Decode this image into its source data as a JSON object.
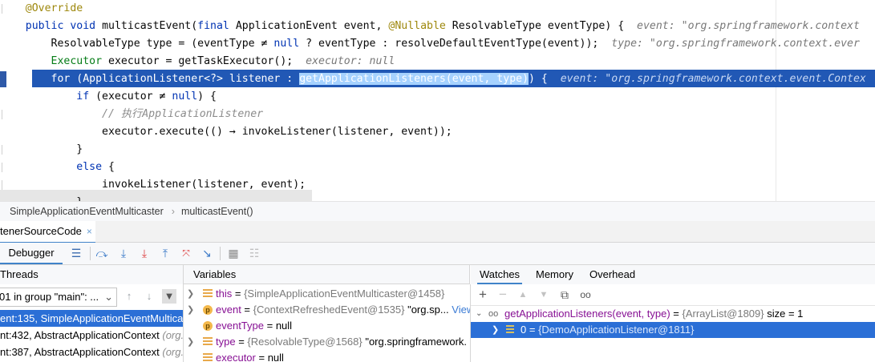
{
  "editor": {
    "lines": [
      {
        "indent": "    ",
        "annotation": "@Override"
      },
      {
        "indent": "    ",
        "kw1": "public",
        "kw2": "void",
        "text": " multicastEvent(",
        "kw3": "final",
        "text2": " ApplicationEvent event, ",
        "ann": "@Nullable",
        "text3": " ResolvableType eventType) {",
        "hint": "event: \"org.springframework.context"
      },
      {
        "indent": "        ",
        "text": "ResolvableType type = (eventType ≠ ",
        "kw": "null",
        "text2": " ? eventType : resolveDefaultEventType(event));",
        "hint": "type: \"org.springframework.context.ever"
      },
      {
        "indent": "        ",
        "cls": "Executor",
        "text": " executor = getTaskExecutor();",
        "hint": "executor: null"
      },
      {
        "indent": "        ",
        "kw": "for",
        "text": " (ApplicationListener<?> listener : ",
        "sel": "getApplicationListeners(event, type)",
        "text2": ") {",
        "hint": "event: \"org.springframework.context.event.Contex"
      },
      {
        "indent": "            ",
        "kw": "if",
        "text": " (executor ≠ ",
        "kw2": "null",
        "text2": ") {"
      },
      {
        "indent": "                ",
        "comment": "// 执行ApplicationListener"
      },
      {
        "indent": "                ",
        "text": "executor.execute(() → invokeListener(listener, event));"
      },
      {
        "indent": "            ",
        "text": "}"
      },
      {
        "indent": "            ",
        "kw": "else",
        "text": " {"
      },
      {
        "indent": "                ",
        "text": "invokeListener(listener, event);"
      },
      {
        "indent": "            ",
        "text": "}"
      }
    ]
  },
  "breadcrumb": {
    "class_name": "SimpleApplicationEventMulticaster",
    "method": "multicastEvent()"
  },
  "debug_tab": {
    "label": "tenerSourceCode",
    "close": "×"
  },
  "toolbar": {
    "debugger_label": "Debugger"
  },
  "threads": {
    "header": "Threads",
    "selected_thread": "01 in group \"main\": ...",
    "frames": [
      {
        "text": "ent:135, SimpleApplicationEventMulticast",
        "extra": ""
      },
      {
        "text": "nt:432, AbstractApplicationContext ",
        "extra": "(org."
      },
      {
        "text": "nt:387, AbstractApplicationContext ",
        "extra": "(org."
      }
    ]
  },
  "variables": {
    "header": "Variables",
    "rows": [
      {
        "name": "this",
        "eq": " = ",
        "val": "{SimpleApplicationEventMulticaster@1458}",
        "extra": "",
        "icon": "field"
      },
      {
        "name": "event",
        "eq": " = ",
        "val": "{ContextRefreshedEvent@1535}",
        "extra": " \"org.sp...",
        "view": "View",
        "icon": "param"
      },
      {
        "name": "eventType",
        "eq": " = ",
        "val": "null",
        "extra": "",
        "icon": "param"
      },
      {
        "name": "type",
        "eq": " = ",
        "val": "{ResolvableType@1568}",
        "extra": " \"org.springframework.",
        "icon": "field"
      },
      {
        "name": "executor",
        "eq": " = ",
        "val": "null",
        "extra": "",
        "icon": "field"
      }
    ]
  },
  "watch_panel": {
    "tabs": [
      "Watches",
      "Memory",
      "Overhead"
    ],
    "rows": [
      {
        "expr": "getApplicationListeners(event, type)",
        "eq": " = ",
        "val": "{ArrayList@1809}",
        "size": "  size = 1"
      },
      {
        "expr": "0",
        "eq": " = ",
        "val": "{DemoApplicationListener@1811}",
        "size": ""
      }
    ]
  },
  "colors": {
    "accent": "#2158b5",
    "selection": "#2b6fd6",
    "keyword": "#0033b3",
    "annotation": "#9e880d"
  }
}
